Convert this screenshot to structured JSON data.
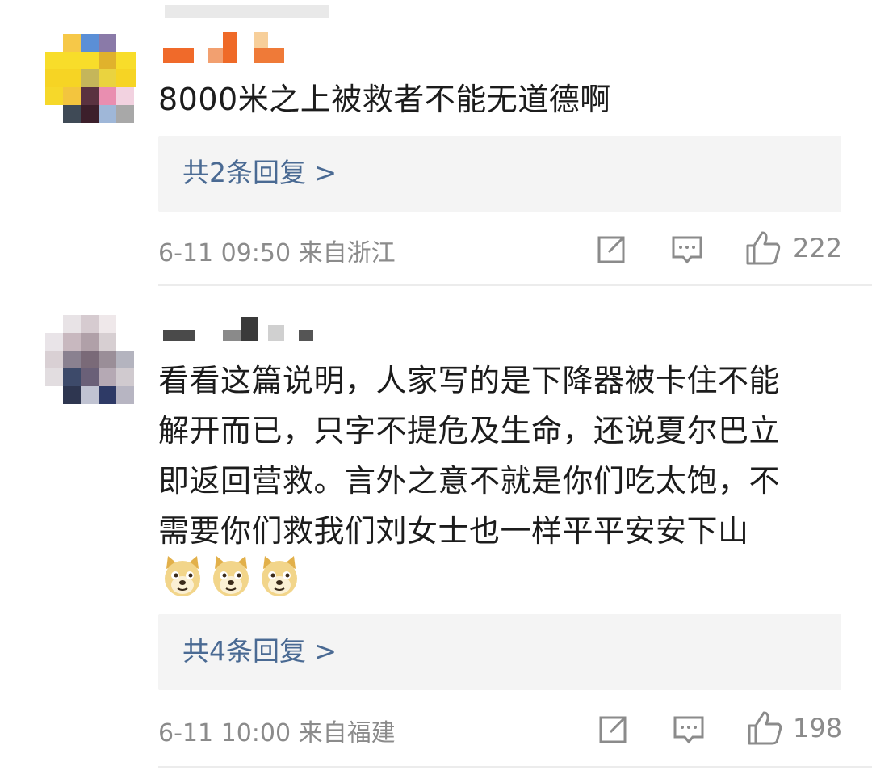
{
  "comments": [
    {
      "text": "8000米之上被救者不能无道德啊",
      "replies_label": "共2条回复 >",
      "meta": "6-11 09:50  来自浙江",
      "likes": "222"
    },
    {
      "lines": [
        "看看这篇说明，人家写的是下降器被卡住不能",
        "解开而已，只字不提危及生命，还说夏尔巴立",
        "即返回营救。言外之意不就是你们吃太饱，不",
        "需要你们救我们刘女士也一样平平安安下山"
      ],
      "emojis": [
        "doge-emoji",
        "doge-emoji",
        "doge-emoji"
      ],
      "replies_label": "共4条回复 >",
      "meta": "6-11 10:00  来自福建",
      "likes": "198"
    }
  ],
  "colors": {
    "link": "#4a6a93",
    "meta": "#8b8b8b",
    "reply_bg": "#f4f4f4"
  }
}
